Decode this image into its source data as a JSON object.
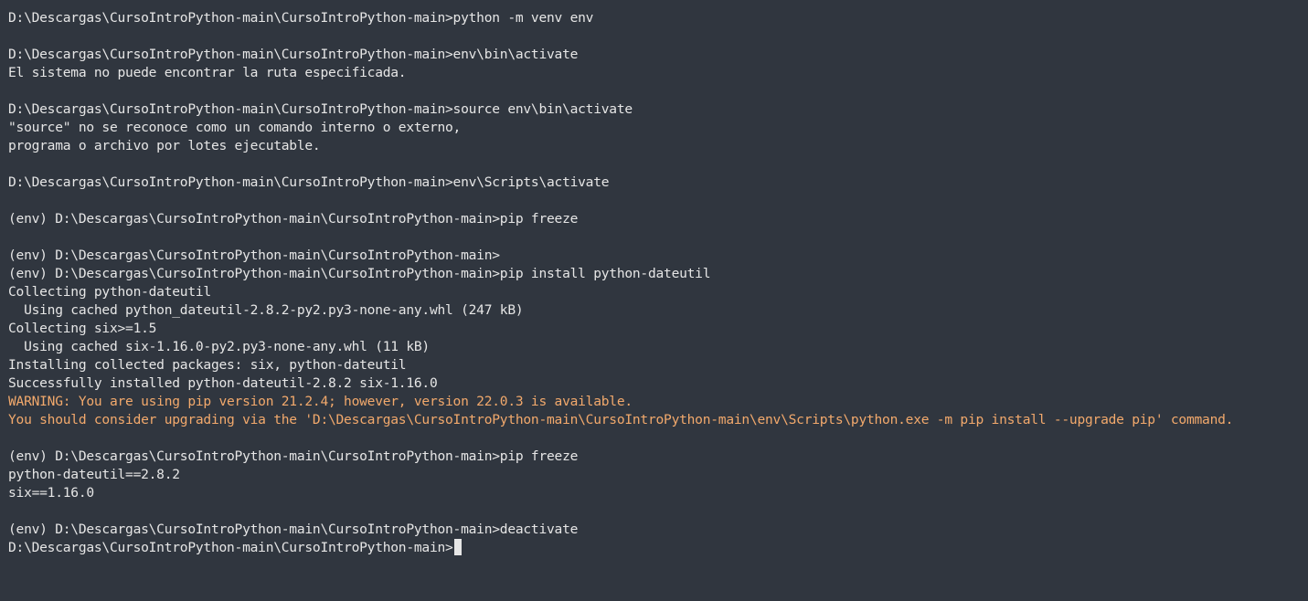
{
  "terminal": {
    "lines": [
      {
        "text": "D:\\Descargas\\CursoIntroPython-main\\CursoIntroPython-main>python -m venv env",
        "kind": "cmd"
      },
      {
        "text": "",
        "kind": "blank"
      },
      {
        "text": "D:\\Descargas\\CursoIntroPython-main\\CursoIntroPython-main>env\\bin\\activate",
        "kind": "cmd"
      },
      {
        "text": "El sistema no puede encontrar la ruta especificada.",
        "kind": "out"
      },
      {
        "text": "",
        "kind": "blank"
      },
      {
        "text": "D:\\Descargas\\CursoIntroPython-main\\CursoIntroPython-main>source env\\bin\\activate",
        "kind": "cmd"
      },
      {
        "text": "\"source\" no se reconoce como un comando interno o externo,",
        "kind": "out"
      },
      {
        "text": "programa o archivo por lotes ejecutable.",
        "kind": "out"
      },
      {
        "text": "",
        "kind": "blank"
      },
      {
        "text": "D:\\Descargas\\CursoIntroPython-main\\CursoIntroPython-main>env\\Scripts\\activate",
        "kind": "cmd"
      },
      {
        "text": "",
        "kind": "blank"
      },
      {
        "text": "(env) D:\\Descargas\\CursoIntroPython-main\\CursoIntroPython-main>pip freeze",
        "kind": "cmd"
      },
      {
        "text": "",
        "kind": "blank"
      },
      {
        "text": "(env) D:\\Descargas\\CursoIntroPython-main\\CursoIntroPython-main>",
        "kind": "cmd"
      },
      {
        "text": "(env) D:\\Descargas\\CursoIntroPython-main\\CursoIntroPython-main>pip install python-dateutil",
        "kind": "cmd"
      },
      {
        "text": "Collecting python-dateutil",
        "kind": "out"
      },
      {
        "text": "  Using cached python_dateutil-2.8.2-py2.py3-none-any.whl (247 kB)",
        "kind": "out"
      },
      {
        "text": "Collecting six>=1.5",
        "kind": "out"
      },
      {
        "text": "  Using cached six-1.16.0-py2.py3-none-any.whl (11 kB)",
        "kind": "out"
      },
      {
        "text": "Installing collected packages: six, python-dateutil",
        "kind": "out"
      },
      {
        "text": "Successfully installed python-dateutil-2.8.2 six-1.16.0",
        "kind": "out"
      },
      {
        "text": "WARNING: You are using pip version 21.2.4; however, version 22.0.3 is available.",
        "kind": "warn"
      },
      {
        "text": "You should consider upgrading via the 'D:\\Descargas\\CursoIntroPython-main\\CursoIntroPython-main\\env\\Scripts\\python.exe -m pip install --upgrade pip' command.",
        "kind": "warn"
      },
      {
        "text": "",
        "kind": "blank"
      },
      {
        "text": "(env) D:\\Descargas\\CursoIntroPython-main\\CursoIntroPython-main>pip freeze",
        "kind": "cmd"
      },
      {
        "text": "python-dateutil==2.8.2",
        "kind": "out"
      },
      {
        "text": "six==1.16.0",
        "kind": "out"
      },
      {
        "text": "",
        "kind": "blank"
      },
      {
        "text": "(env) D:\\Descargas\\CursoIntroPython-main\\CursoIntroPython-main>deactivate",
        "kind": "cmd"
      }
    ],
    "prompt": "D:\\Descargas\\CursoIntroPython-main\\CursoIntroPython-main>"
  },
  "colors": {
    "background": "#30363f",
    "text": "#e6e6e6",
    "warning": "#f2a96c"
  }
}
